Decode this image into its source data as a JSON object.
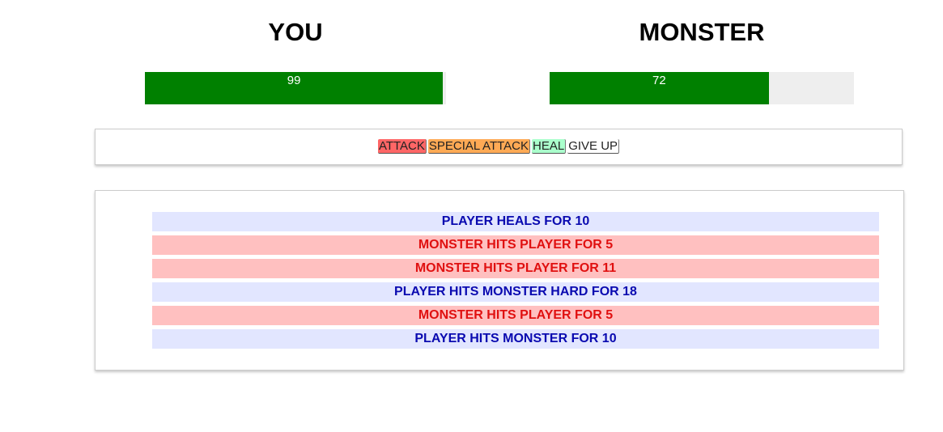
{
  "player": {
    "name": "YOU",
    "health": 99,
    "health_label": "99",
    "bar_color": "#008000"
  },
  "monster": {
    "name": "MONSTER",
    "health": 72,
    "health_label": "72",
    "bar_color": "#008000"
  },
  "controls": {
    "attack_label": "ATTACK",
    "special_attack_label": "SPECIAL ATTACK",
    "heal_label": "HEAL",
    "give_up_label": "GIVE UP"
  },
  "log": [
    {
      "text": "PLAYER HEALS FOR 10",
      "actor": "player"
    },
    {
      "text": "MONSTER HITS PLAYER FOR 5",
      "actor": "monster"
    },
    {
      "text": "MONSTER HITS PLAYER FOR 11",
      "actor": "monster"
    },
    {
      "text": "PLAYER HITS MONSTER HARD FOR 18",
      "actor": "player"
    },
    {
      "text": "MONSTER HITS PLAYER FOR 5",
      "actor": "monster"
    },
    {
      "text": "PLAYER HITS MONSTER FOR 10",
      "actor": "player"
    }
  ],
  "colors": {
    "attack": "#ff6666",
    "special_attack": "#ffaa55",
    "heal": "#aaffcc",
    "player_log_bg": "#e2e6ff",
    "player_log_text": "#0a0ab0",
    "monster_log_bg": "#ffc0c0",
    "monster_log_text": "#e01010"
  }
}
